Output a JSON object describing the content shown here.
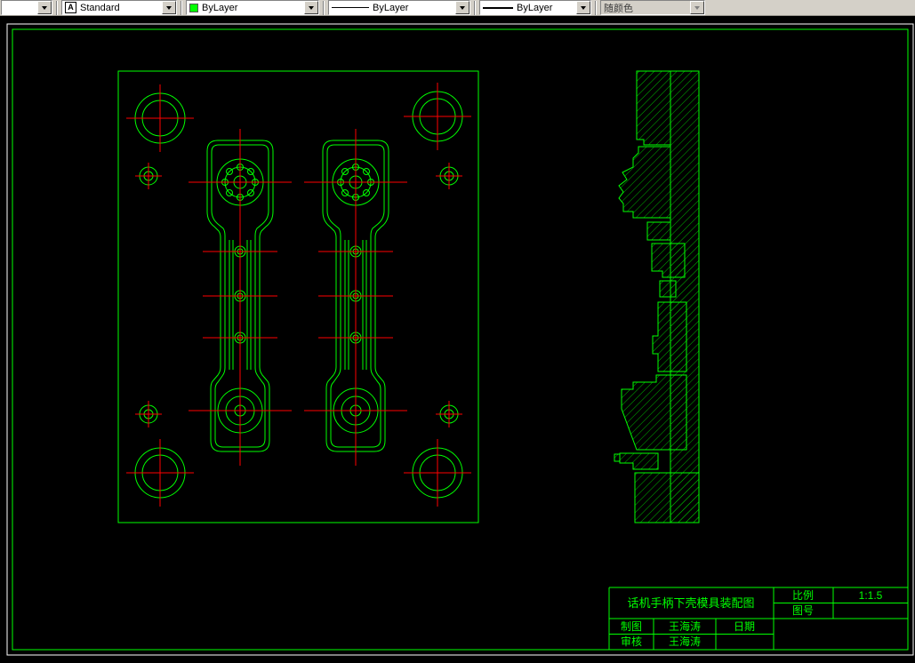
{
  "toolbar": {
    "unnamed_combo": {
      "value": ""
    },
    "text_style_combo": {
      "value": "Standard"
    },
    "color_combo": {
      "value": "ByLayer",
      "swatch_color": "#00ff00"
    },
    "linetype_combo": {
      "value": "ByLayer"
    },
    "lineweight_combo": {
      "value": "ByLayer"
    },
    "plot_style_combo": {
      "value": "随颜色"
    }
  },
  "drawing": {
    "colors": {
      "outline": "#00ff00",
      "centerline": "#ff0000",
      "hatch": "#00b800",
      "sheet_frame": "#00ff00",
      "window_border": "#ffffff",
      "background": "#000000"
    }
  },
  "title_block": {
    "title": "话机手柄下壳模具装配图",
    "scale_label": "比例",
    "scale_value": "1:1.5",
    "drawing_number_label": "图号",
    "drafter_label": "制图",
    "drafter_name": "王海涛",
    "date_label": "日期",
    "reviewer_label": "审核",
    "reviewer_name": "王海涛"
  }
}
